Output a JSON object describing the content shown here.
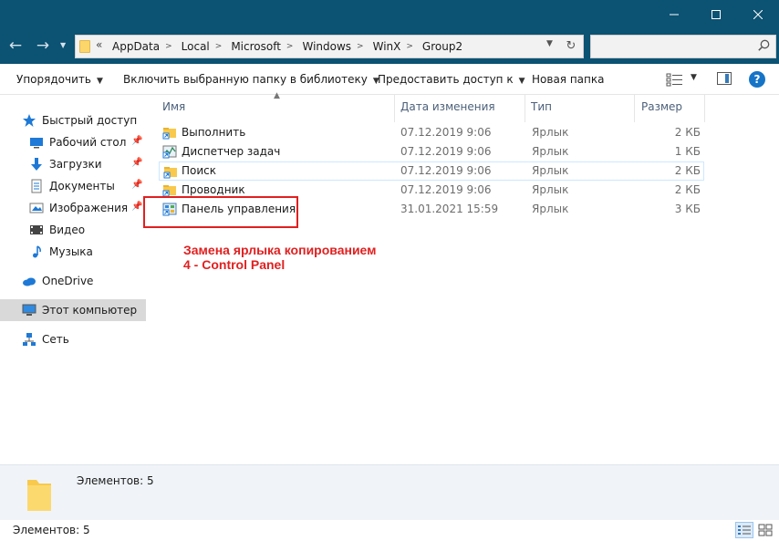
{
  "navigation": {
    "breadcrumbs": [
      "AppData",
      "Local",
      "Microsoft",
      "Windows",
      "WinX",
      "Group2"
    ]
  },
  "commands": {
    "organize": "Упорядочить",
    "include_library": "Включить выбранную папку в библиотеку",
    "share": "Предоставить доступ к",
    "new_folder": "Новая папка"
  },
  "sidebar": {
    "quick_access": "Быстрый доступ",
    "items": [
      {
        "label": "Рабочий стол",
        "icon": "desktop-icon",
        "pinned": true
      },
      {
        "label": "Загрузки",
        "icon": "download-icon",
        "pinned": true
      },
      {
        "label": "Документы",
        "icon": "documents-icon",
        "pinned": true
      },
      {
        "label": "Изображения",
        "icon": "pictures-icon",
        "pinned": true
      },
      {
        "label": "Видео",
        "icon": "video-icon",
        "pinned": false
      },
      {
        "label": "Музыка",
        "icon": "music-icon",
        "pinned": false
      }
    ],
    "onedrive": "OneDrive",
    "this_pc": "Этот компьютер",
    "network": "Сеть"
  },
  "columns": {
    "name": "Имя",
    "date": "Дата изменения",
    "type": "Тип",
    "size": "Размер"
  },
  "files": [
    {
      "name": "Выполнить",
      "date": "07.12.2019 9:06",
      "type": "Ярлык",
      "size": "2 КБ",
      "icon": "folder-shortcut-icon"
    },
    {
      "name": "Диспетчер задач",
      "date": "07.12.2019 9:06",
      "type": "Ярлык",
      "size": "1 КБ",
      "icon": "taskmgr-shortcut-icon"
    },
    {
      "name": "Поиск",
      "date": "07.12.2019 9:06",
      "type": "Ярлык",
      "size": "2 КБ",
      "icon": "folder-shortcut-icon"
    },
    {
      "name": "Проводник",
      "date": "07.12.2019 9:06",
      "type": "Ярлык",
      "size": "2 КБ",
      "icon": "folder-shortcut-icon"
    },
    {
      "name": "Панель управления",
      "date": "31.01.2021 15:59",
      "type": "Ярлык",
      "size": "3 КБ",
      "icon": "control-panel-shortcut-icon"
    }
  ],
  "annotation": {
    "line1": "Замена ярлыка копированием",
    "line2": "4 - Control Panel",
    "color": "#e02020"
  },
  "details_pane": {
    "count_text": "Элементов: 5"
  },
  "status": {
    "count_text": "Элементов: 5"
  },
  "colors": {
    "titlebar": "#0b5273",
    "selection": "#cce8ff",
    "accent": "#1674c7"
  }
}
